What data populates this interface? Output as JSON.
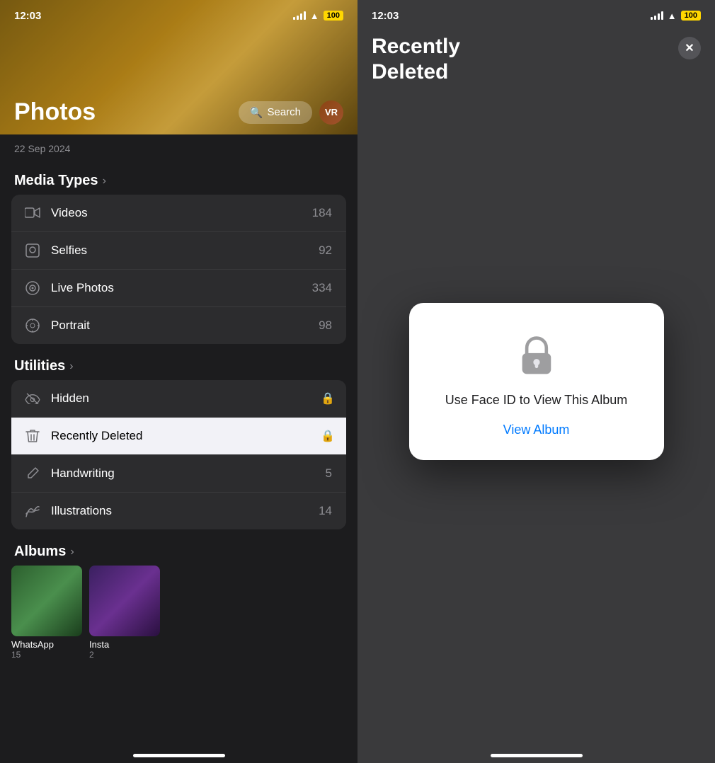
{
  "left": {
    "status": {
      "time": "12:03",
      "battery": "100"
    },
    "header": {
      "title": "Photos",
      "search_label": "Search",
      "avatar_label": "VR",
      "date": "22 Sep 2024"
    },
    "media_types": {
      "section_title": "Media Types",
      "items": [
        {
          "label": "Videos",
          "count": "184",
          "icon": "video"
        },
        {
          "label": "Selfies",
          "count": "92",
          "icon": "selfie"
        },
        {
          "label": "Live Photos",
          "count": "334",
          "icon": "live"
        },
        {
          "label": "Portrait",
          "count": "98",
          "icon": "portrait"
        }
      ]
    },
    "utilities": {
      "section_title": "Utilities",
      "items": [
        {
          "label": "Hidden",
          "count": "",
          "icon": "eye-slash",
          "lock": true
        },
        {
          "label": "Recently Deleted",
          "count": "",
          "icon": "trash",
          "lock": true,
          "highlighted": true
        },
        {
          "label": "Handwriting",
          "count": "5",
          "icon": "pencil",
          "lock": false
        },
        {
          "label": "Illustrations",
          "count": "14",
          "icon": "illustration",
          "lock": false
        }
      ]
    },
    "albums": {
      "section_title": "Albums",
      "items": [
        {
          "label": "WhatsApp",
          "count": "15"
        },
        {
          "label": "Insta",
          "count": "2"
        }
      ]
    }
  },
  "right": {
    "status": {
      "time": "12:03",
      "battery": "100"
    },
    "title_line1": "Recently",
    "title_line2": "Deleted",
    "close_label": "✕",
    "modal": {
      "lock_label": "lock",
      "face_id_text": "Use Face ID to View This Album",
      "view_album_label": "View Album"
    }
  }
}
